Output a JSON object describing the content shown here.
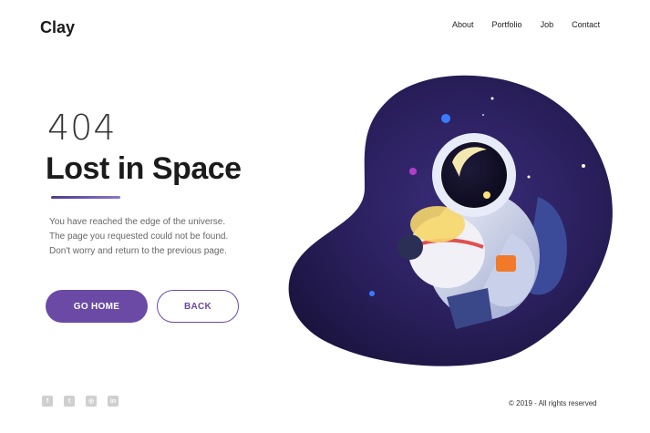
{
  "header": {
    "logo": "Clay",
    "nav": [
      {
        "label": "About"
      },
      {
        "label": "Portfolio"
      },
      {
        "label": "Job"
      },
      {
        "label": "Contact"
      }
    ]
  },
  "main": {
    "code": "404",
    "title": "Lost in Space",
    "description": [
      "You have reached the edge of the universe.",
      "The page you requested could not be found.",
      "Don't worry and return to the previous page."
    ],
    "buttons": {
      "home": "GO HOME",
      "back": "BACK"
    },
    "accent_color": "#6a4aa5"
  },
  "illustration": {
    "subject": "astronaut-illustration",
    "blob_color": "#2a1f5c"
  },
  "footer": {
    "socials": [
      {
        "icon": "facebook-icon",
        "glyph": "f"
      },
      {
        "icon": "twitter-icon",
        "glyph": "t"
      },
      {
        "icon": "instagram-icon",
        "glyph": "◎"
      },
      {
        "icon": "linkedin-icon",
        "glyph": "in"
      }
    ],
    "copyright": "© 2019 - All rights reserved"
  }
}
